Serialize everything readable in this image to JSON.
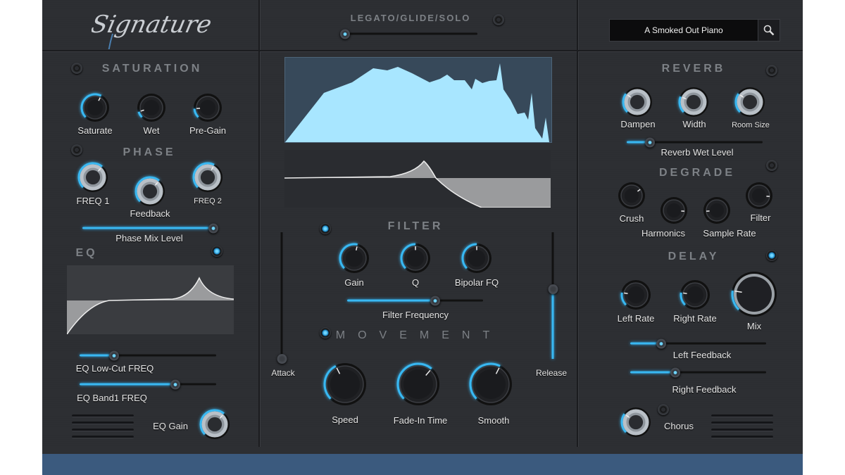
{
  "app": {
    "logo_text": "Signature",
    "accent_color": "#39b8f2",
    "bottom_bar_color": "#3b5a7e"
  },
  "header": {
    "legato_label": "LEGATO/GLIDE/SOLO",
    "legato_value": 0,
    "preset_name": "A Smoked Out Piano",
    "search_icon": "magnifier-icon"
  },
  "saturation": {
    "title": "SATURATION",
    "enabled": false,
    "knobs": [
      {
        "label": "Saturate",
        "value": 0.6
      },
      {
        "label": "Wet",
        "value": 0.1
      },
      {
        "label": "Pre-Gain",
        "value": 0.15
      }
    ]
  },
  "phase": {
    "title": "PHASE",
    "enabled": false,
    "knobs": [
      {
        "label": "FREQ 1",
        "value": 0.65
      },
      {
        "label": "Feedback",
        "value": 0.65
      },
      {
        "label": "FREQ 2",
        "value": 0.6
      }
    ],
    "mix_label": "Phase Mix Level",
    "mix_value": 1.0
  },
  "eq": {
    "title": "EQ",
    "enabled": true,
    "lowcut_label": "EQ Low-Cut FREQ",
    "lowcut_value": 0.25,
    "band1_label": "EQ Band1 FREQ",
    "band1_value": 0.7,
    "gain_label": "EQ Gain",
    "gain_value": 0.65
  },
  "filter": {
    "title": "FILTER",
    "enabled": true,
    "knobs": [
      {
        "label": "Gain",
        "value": 0.55
      },
      {
        "label": "Q",
        "value": 0.5
      },
      {
        "label": "Bipolar FQ",
        "value": 0.5
      }
    ],
    "freq_label": "Filter Frequency",
    "freq_value": 0.65
  },
  "envelope": {
    "attack_label": "Attack",
    "attack_value": 0.0,
    "release_label": "Release",
    "release_value": 0.55
  },
  "movement": {
    "title": "MOVEMENT",
    "enabled": true,
    "knobs": [
      {
        "label": "Speed",
        "value": 0.4
      },
      {
        "label": "Fade-In Time",
        "value": 0.65
      },
      {
        "label": "Smooth",
        "value": 0.6
      }
    ]
  },
  "reverb": {
    "title": "REVERB",
    "enabled": false,
    "knobs": [
      {
        "label": "Dampen",
        "value": 0.3
      },
      {
        "label": "Width",
        "value": 0.25
      },
      {
        "label": "Room Size",
        "value": 0.3
      }
    ],
    "wet_label": "Reverb Wet Level",
    "wet_value": 0.17
  },
  "degrade": {
    "title": "DEGRADE",
    "enabled": false,
    "knobs": [
      {
        "label": "Crush",
        "value": 0.7
      },
      {
        "label": "Harmonics",
        "value": 0.85
      },
      {
        "label": "Sample Rate",
        "value": 0.15
      },
      {
        "label": "Filter",
        "value": 0.85
      }
    ]
  },
  "delay": {
    "title": "DELAY",
    "enabled": true,
    "knobs": [
      {
        "label": "Left Rate",
        "value": 0.2
      },
      {
        "label": "Right Rate",
        "value": 0.2
      },
      {
        "label": "Mix",
        "value": 0.2
      }
    ],
    "left_feedback_label": "Left Feedback",
    "left_feedback_value": 0.23,
    "right_feedback_label": "Right Feedback",
    "right_feedback_value": 0.33
  },
  "chorus": {
    "label": "Chorus",
    "value": 0.3,
    "enabled": false
  }
}
